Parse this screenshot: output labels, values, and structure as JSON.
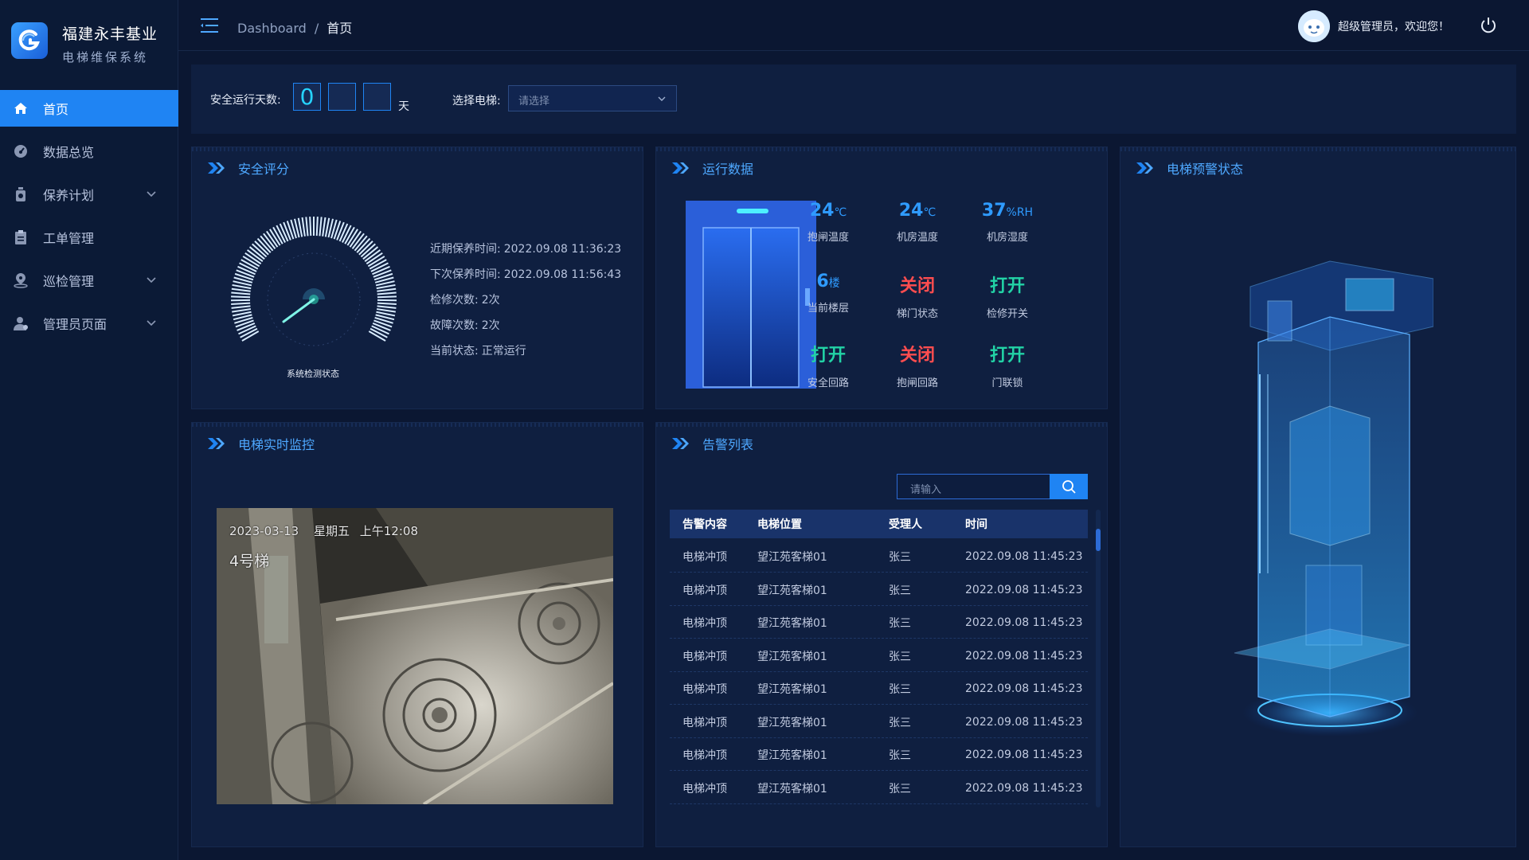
{
  "brand": {
    "title": "福建永丰基业",
    "subtitle": "电梯维保系统"
  },
  "menu": [
    {
      "label": "首页",
      "icon": "home-icon",
      "active": true,
      "expandable": false
    },
    {
      "label": "数据总览",
      "icon": "dashboard-icon",
      "active": false,
      "expandable": false
    },
    {
      "label": "保养计划",
      "icon": "bottle-icon",
      "active": false,
      "expandable": true
    },
    {
      "label": "工单管理",
      "icon": "clipboard-icon",
      "active": false,
      "expandable": false
    },
    {
      "label": "巡检管理",
      "icon": "location-icon",
      "active": false,
      "expandable": true
    },
    {
      "label": "管理员页面",
      "icon": "user-icon",
      "active": false,
      "expandable": true
    }
  ],
  "header": {
    "breadcrumb": [
      "Dashboard",
      "首页"
    ],
    "separator": "/",
    "welcome": "超级管理员，欢迎您！"
  },
  "topbar": {
    "safe_days_label": "安全运行天数:",
    "safe_days_digits": [
      "0",
      "",
      ""
    ],
    "days_unit": "天",
    "select_label": "选择电梯:",
    "select_placeholder": "请选择"
  },
  "safety": {
    "title": "安全评分",
    "gauge_label": "系统检测状态",
    "info": [
      {
        "label": "近期保养时间:",
        "value": "2022.09.08 11:36:23"
      },
      {
        "label": "下次保养时间:",
        "value": "2022.09.08 11:56:43"
      },
      {
        "label": "检修次数:",
        "value": "2次"
      },
      {
        "label": "故障次数:",
        "value": "2次"
      },
      {
        "label": "当前状态:",
        "value": "正常运行"
      }
    ]
  },
  "running": {
    "title": "运行数据",
    "metrics": [
      {
        "value": "24",
        "unit": "℃",
        "label": "抱闸温度",
        "color": "#2f9bff"
      },
      {
        "value": "24",
        "unit": "℃",
        "label": "机房温度",
        "color": "#2f9bff"
      },
      {
        "value": "37",
        "unit": "%RH",
        "label": "机房湿度",
        "color": "#2f9bff"
      },
      {
        "value": "6",
        "unit": "楼",
        "label": "当前楼层",
        "color": "#2f9bff"
      },
      {
        "value": "关闭",
        "unit": "",
        "label": "梯门状态",
        "color": "#ff4d4f"
      },
      {
        "value": "打开",
        "unit": "",
        "label": "检修开关",
        "color": "#22d3a6"
      },
      {
        "value": "打开",
        "unit": "",
        "label": "安全回路",
        "color": "#22d3a6"
      },
      {
        "value": "关闭",
        "unit": "",
        "label": "抱闸回路",
        "color": "#ff4d4f"
      },
      {
        "value": "打开",
        "unit": "",
        "label": "门联锁",
        "color": "#22d3a6"
      }
    ]
  },
  "warning": {
    "title": "电梯预警状态"
  },
  "monitor": {
    "title": "电梯实时监控",
    "overlay_date": "2023-03-13",
    "overlay_day": "星期五",
    "overlay_time": "上午12:08",
    "overlay_elevator": "4号梯"
  },
  "alarms": {
    "title": "告警列表",
    "search_placeholder": "请输入",
    "columns": [
      "告警内容",
      "电梯位置",
      "受理人",
      "时间"
    ],
    "rows": [
      [
        "电梯冲顶",
        "望江苑客梯01",
        "张三",
        "2022.09.08 11:45:23"
      ],
      [
        "电梯冲顶",
        "望江苑客梯01",
        "张三",
        "2022.09.08 11:45:23"
      ],
      [
        "电梯冲顶",
        "望江苑客梯01",
        "张三",
        "2022.09.08 11:45:23"
      ],
      [
        "电梯冲顶",
        "望江苑客梯01",
        "张三",
        "2022.09.08 11:45:23"
      ],
      [
        "电梯冲顶",
        "望江苑客梯01",
        "张三",
        "2022.09.08 11:45:23"
      ],
      [
        "电梯冲顶",
        "望江苑客梯01",
        "张三",
        "2022.09.08 11:45:23"
      ],
      [
        "电梯冲顶",
        "望江苑客梯01",
        "张三",
        "2022.09.08 11:45:23"
      ],
      [
        "电梯冲顶",
        "望江苑客梯01",
        "张三",
        "2022.09.08 11:45:23"
      ]
    ]
  },
  "colors": {
    "accent": "#1f84f3",
    "title": "#4ea8ff",
    "danger": "#ff4d4f",
    "ok": "#22d3a6"
  }
}
